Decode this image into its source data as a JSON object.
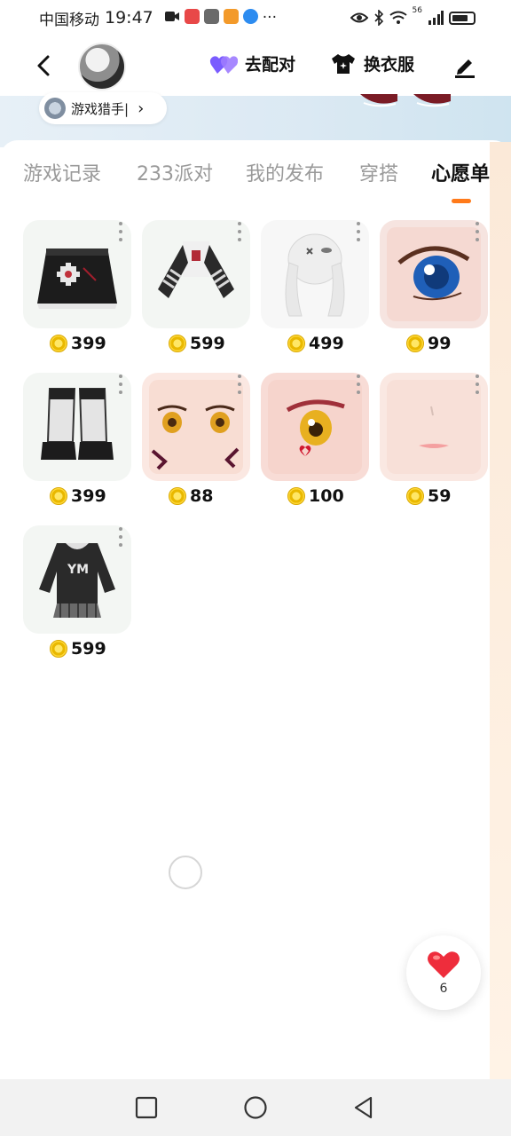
{
  "status_bar": {
    "carrier": "中国移动",
    "time": "19:47",
    "more": "···",
    "signal_label": "56"
  },
  "header": {
    "back_icon": "chevron-left-icon",
    "pair_label": "去配对",
    "pair_icon": "heart-pair-icon",
    "dress_label": "换衣服",
    "dress_icon": "tshirt-icon",
    "edit_icon": "pencil-icon"
  },
  "profile": {
    "title_tag": "游戏猎手|",
    "tag_chevron": "›"
  },
  "tabs": [
    {
      "label": "游戏记录",
      "active": false
    },
    {
      "label": "233派对",
      "active": false
    },
    {
      "label": "我的发布",
      "active": false
    },
    {
      "label": "穿搭",
      "active": false
    },
    {
      "label": "心愿单",
      "active": true
    }
  ],
  "wishlist": {
    "items": [
      {
        "price": "399",
        "image": "black-skirt"
      },
      {
        "price": "599",
        "image": "striped-top"
      },
      {
        "price": "499",
        "image": "white-hair"
      },
      {
        "price": "99",
        "image": "blue-eye"
      },
      {
        "price": "399",
        "image": "white-boots"
      },
      {
        "price": "88",
        "image": "yellow-eye-face"
      },
      {
        "price": "100",
        "image": "pink-eye-heart"
      },
      {
        "price": "59",
        "image": "lip-face"
      },
      {
        "price": "599",
        "image": "ym-hoodie"
      }
    ],
    "coin_icon": "coin-icon"
  },
  "wish_fab": {
    "count": "6",
    "icon": "heart-icon"
  },
  "colors": {
    "accent": "#ff7a1a",
    "coin": "#f2c200",
    "tab_active": "#111111",
    "tab_inactive": "#9a9a9a"
  }
}
